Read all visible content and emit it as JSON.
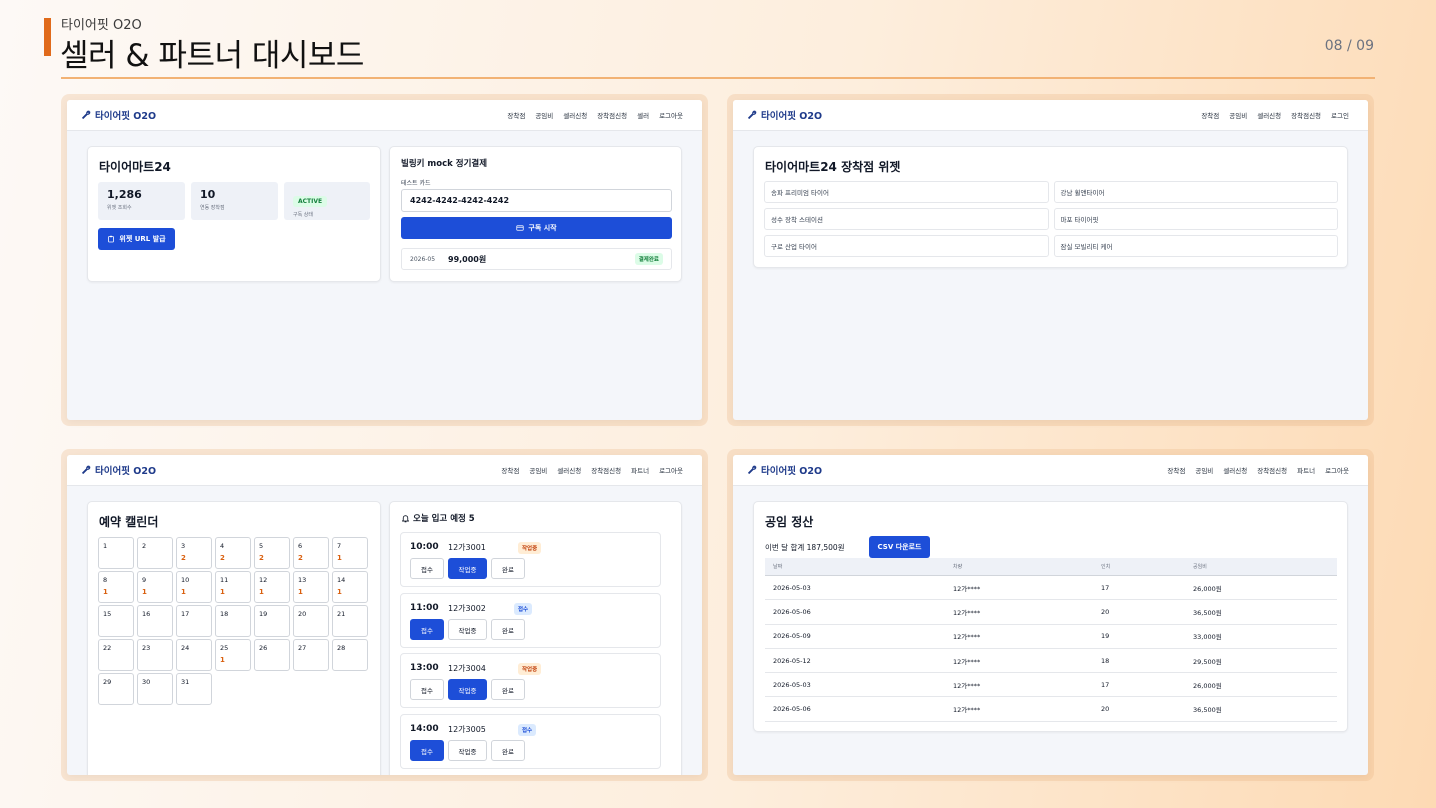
{
  "header": {
    "subtitle": "타이어핏 O2O",
    "title": "셀러 & 파트너 대시보드",
    "page": "08 / 09"
  },
  "colors": {
    "accent": "#e06a1b",
    "primary": "#1d4ed8",
    "brand": "#1e3a8a",
    "success": "#15803d",
    "warning": "#d95f0e"
  },
  "brand": "타이어핏 O2O",
  "nav_a": [
    "장착점",
    "공임비",
    "셀러신청",
    "장착점신청",
    "셀러",
    "로그아웃"
  ],
  "nav_b": [
    "장착점",
    "공임비",
    "셀러신청",
    "장착점신청",
    "로그인"
  ],
  "nav_c": [
    "장착점",
    "공임비",
    "셀러신청",
    "장착점신청",
    "파트너",
    "로그아웃"
  ],
  "seller": {
    "name": "타이어마트24",
    "stats": [
      {
        "value": "1,286",
        "label": "위젯 조회수"
      },
      {
        "value": "10",
        "label": "연동 장착점"
      }
    ],
    "status_badge": "ACTIVE",
    "status_label": "구독 상태",
    "widget_button": "위젯 URL 발급"
  },
  "billing": {
    "title": "빌링키 mock 정기결제",
    "card_label": "테스트 카드",
    "card_value": "4242-4242-4242-4242",
    "start_button": "구독 시작",
    "payment": {
      "month": "2026-05",
      "amount": "99,000원",
      "status": "결제완료"
    }
  },
  "widget": {
    "title": "타이어마트24 장착점 위젯",
    "shops": [
      "송파 프리미엄 타이어",
      "강남 휠앤타이어",
      "성수 장착 스테이션",
      "마포 타이어핏",
      "구로 산업 타이어",
      "잠실 모빌리티 케어"
    ]
  },
  "calendar": {
    "title": "예약 캘린더",
    "days": [
      {
        "d": "1",
        "c": ""
      },
      {
        "d": "2",
        "c": ""
      },
      {
        "d": "3",
        "c": "2"
      },
      {
        "d": "4",
        "c": "2"
      },
      {
        "d": "5",
        "c": "2"
      },
      {
        "d": "6",
        "c": "2"
      },
      {
        "d": "7",
        "c": "1"
      },
      {
        "d": "8",
        "c": "1"
      },
      {
        "d": "9",
        "c": "1"
      },
      {
        "d": "10",
        "c": "1"
      },
      {
        "d": "11",
        "c": "1"
      },
      {
        "d": "12",
        "c": "1"
      },
      {
        "d": "13",
        "c": "1"
      },
      {
        "d": "14",
        "c": "1"
      },
      {
        "d": "15",
        "c": ""
      },
      {
        "d": "16",
        "c": ""
      },
      {
        "d": "17",
        "c": ""
      },
      {
        "d": "18",
        "c": ""
      },
      {
        "d": "19",
        "c": ""
      },
      {
        "d": "20",
        "c": ""
      },
      {
        "d": "21",
        "c": ""
      },
      {
        "d": "22",
        "c": ""
      },
      {
        "d": "23",
        "c": ""
      },
      {
        "d": "24",
        "c": ""
      },
      {
        "d": "25",
        "c": "1"
      },
      {
        "d": "26",
        "c": ""
      },
      {
        "d": "27",
        "c": ""
      },
      {
        "d": "28",
        "c": ""
      },
      {
        "d": "29",
        "c": ""
      },
      {
        "d": "30",
        "c": ""
      },
      {
        "d": "31",
        "c": ""
      }
    ]
  },
  "today": {
    "title": "오늘 입고 예정 5",
    "actions": [
      "접수",
      "작업중",
      "완료"
    ],
    "items": [
      {
        "time": "10:00",
        "plate": "12가3001",
        "status": "작업중",
        "active": 1
      },
      {
        "time": "11:00",
        "plate": "12가3002",
        "status": "접수",
        "active": 0
      },
      {
        "time": "13:00",
        "plate": "12가3004",
        "status": "작업중",
        "active": 1
      },
      {
        "time": "14:00",
        "plate": "12가3005",
        "status": "접수",
        "active": 0
      }
    ]
  },
  "settlement": {
    "title": "공임 정산",
    "total": "이번 달 합계 187,500원",
    "csv_button": "CSV 다운로드",
    "columns": [
      "날짜",
      "차량",
      "인치",
      "공임비"
    ],
    "rows": [
      [
        "2026-05-03",
        "12가****",
        "17",
        "26,000원"
      ],
      [
        "2026-05-06",
        "12가****",
        "20",
        "36,500원"
      ],
      [
        "2026-05-09",
        "12가****",
        "19",
        "33,000원"
      ],
      [
        "2026-05-12",
        "12가****",
        "18",
        "29,500원"
      ],
      [
        "2026-05-03",
        "12가****",
        "17",
        "26,000원"
      ],
      [
        "2026-05-06",
        "12가****",
        "20",
        "36,500원"
      ]
    ]
  }
}
